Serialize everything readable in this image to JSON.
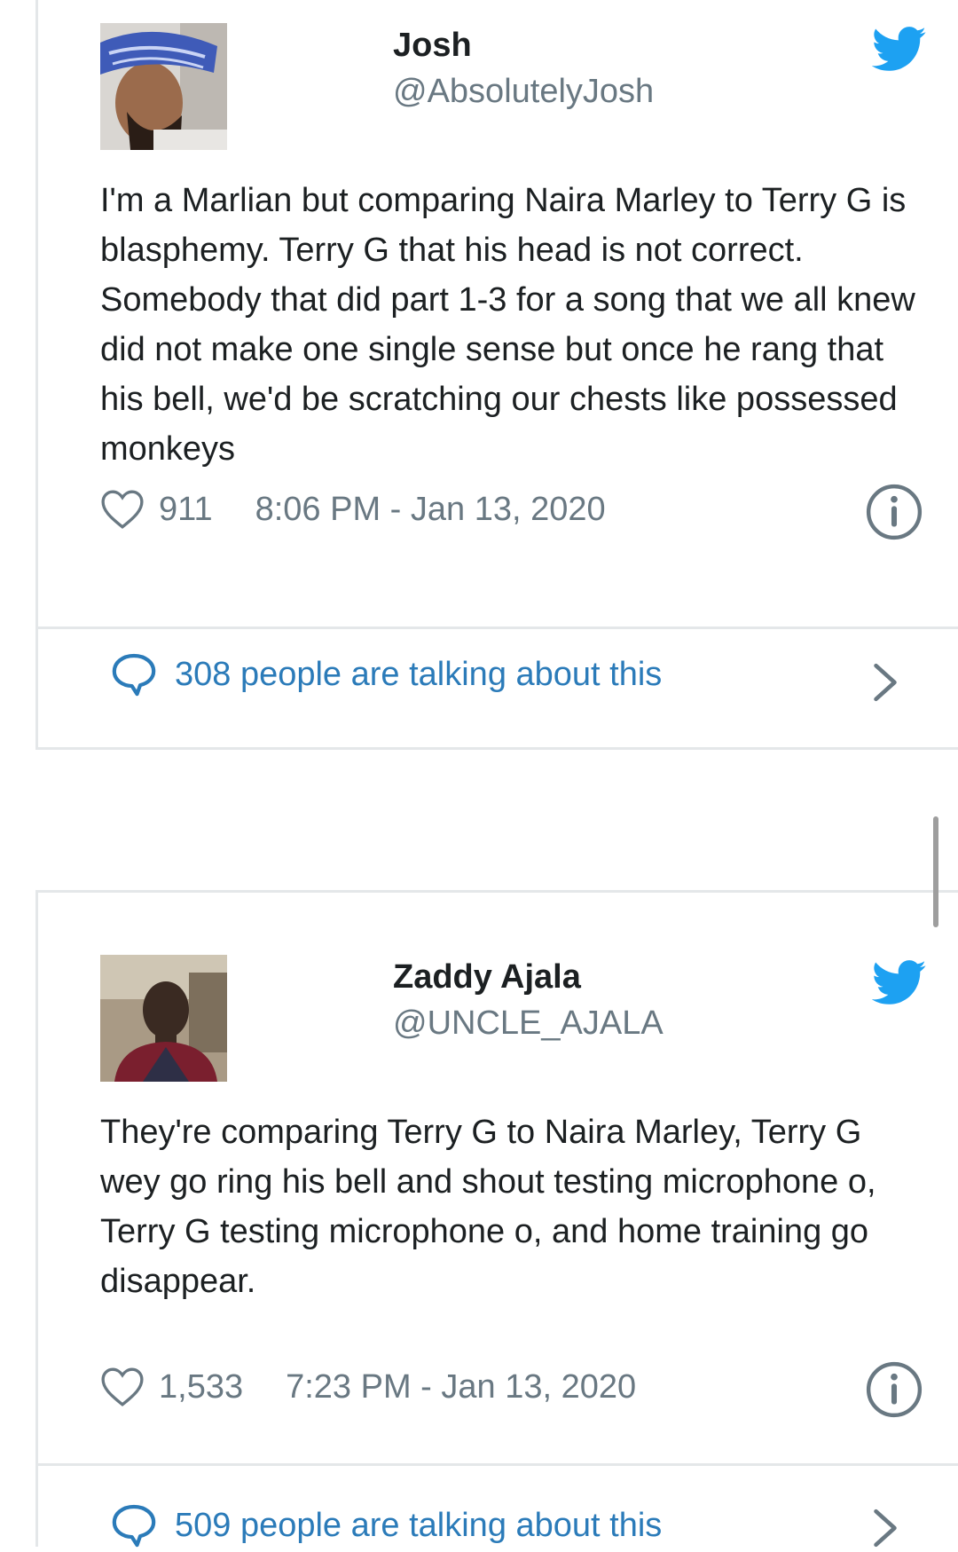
{
  "colors": {
    "twitter_blue": "#1da1f2",
    "link_blue": "#2b7bb9",
    "meta_gray": "#697882",
    "text_dark": "#1c2022",
    "divider": "#e4e7e9"
  },
  "icons": {
    "brand": "twitter-bird-icon",
    "like": "heart-icon",
    "info": "info-icon",
    "conversation": "speech-bubble-icon",
    "navigate": "chevron-right-icon"
  },
  "tweets": [
    {
      "name": "Josh",
      "handle": "@AbsolutelyJosh",
      "text": "I'm a Marlian but comparing Naira  Marley to Terry G is blasphemy. Terry G that his head is not correct. Somebody that did part 1-3 for a song that we all knew did not make one single sense but once he rang that his bell, we'd be scratching our chests like possessed monkeys",
      "likes": "911",
      "timestamp": "8:06 PM - Jan 13, 2020",
      "talking": "308 people are talking about this"
    },
    {
      "name": "Zaddy Ajala",
      "handle": "@UNCLE_AJALA",
      "text": "They're comparing Terry G to Naira Marley,  Terry G wey go ring his bell and shout testing microphone o, Terry G testing microphone o, and home training go disappear.",
      "likes": "1,533",
      "timestamp": "7:23 PM - Jan 13, 2020",
      "talking": "509 people are talking about this"
    }
  ]
}
